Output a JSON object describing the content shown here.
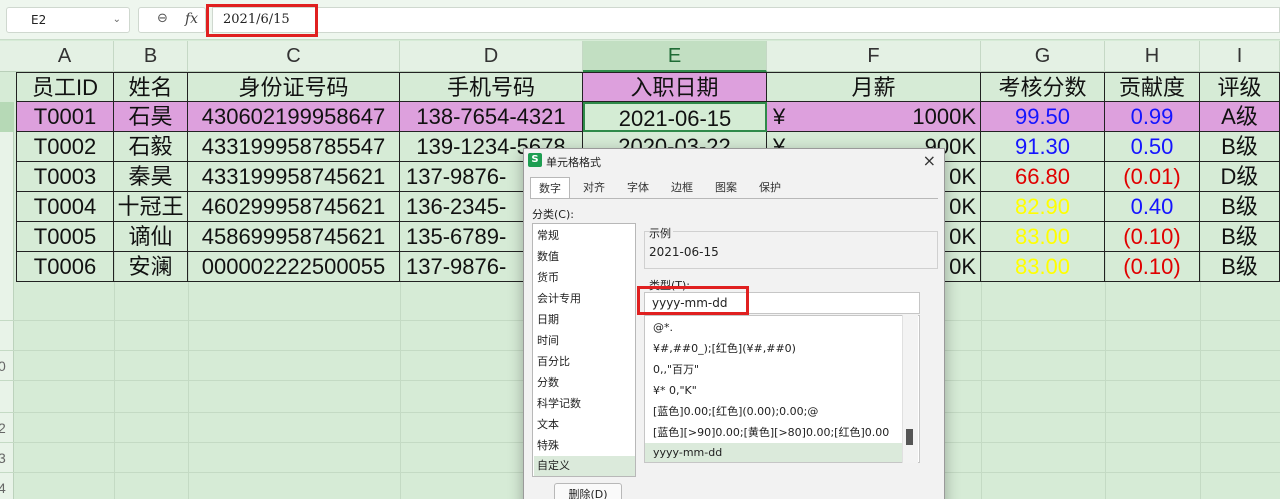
{
  "formula_bar": {
    "namebox": "E2",
    "zoom_icon": "⊖",
    "fx_label": "fx",
    "formula_value": "2021/6/15"
  },
  "columns": [
    "A",
    "B",
    "C",
    "D",
    "E",
    "F",
    "G",
    "H",
    "I"
  ],
  "row_numbers": [
    "0",
    "2",
    "3",
    "4"
  ],
  "table": {
    "headers": [
      "员工ID",
      "姓名",
      "身份证号码",
      "手机号码",
      "入职日期",
      "月薪",
      "考核分数",
      "贡献度",
      "评级"
    ],
    "rows": [
      {
        "id": "T0001",
        "name": "石昊",
        "idcard": "430602199958647",
        "phone": "138-7654-4321",
        "date": "2021-06-15",
        "yen": "¥",
        "salary": "1000K",
        "score": "99.50",
        "contrib": "0.99",
        "grade": "A级"
      },
      {
        "id": "T0002",
        "name": "石毅",
        "idcard": "433199958785547",
        "phone": "139-1234-5678",
        "date": "2020-03-22",
        "yen": "¥",
        "salary": "900K",
        "score": "91.30",
        "contrib": "0.50",
        "grade": "B级"
      },
      {
        "id": "T0003",
        "name": "秦昊",
        "idcard": "433199958745621",
        "phone": "137-9876-",
        "date": "",
        "yen": "",
        "salary": "0K",
        "score": "66.80",
        "contrib": "(0.01)",
        "grade": "D级"
      },
      {
        "id": "T0004",
        "name": "十冠王",
        "idcard": "460299958745621",
        "phone": "136-2345-",
        "date": "",
        "yen": "",
        "salary": "0K",
        "score": "82.90",
        "contrib": "0.40",
        "grade": "B级"
      },
      {
        "id": "T0005",
        "name": "谪仙",
        "idcard": "458699958745621",
        "phone": "135-6789-",
        "date": "",
        "yen": "",
        "salary": "0K",
        "score": "83.00",
        "contrib": "(0.10)",
        "grade": "B级"
      },
      {
        "id": "T0006",
        "name": "安澜",
        "idcard": "000002222500055",
        "phone": "137-9876-",
        "date": "",
        "yen": "",
        "salary": "0K",
        "score": "83.00",
        "contrib": "(0.10)",
        "grade": "B级"
      }
    ]
  },
  "colors": {
    "score_blue": "#1515ff",
    "score_red": "#e00000",
    "score_yellow": "#ffff00",
    "highlight_row": "#dda0dd",
    "annotation_red": "#e02020"
  },
  "dialog": {
    "logo": "S",
    "title": "单元格格式",
    "close": "×",
    "tabs": [
      "数字",
      "对齐",
      "字体",
      "边框",
      "图案",
      "保护"
    ],
    "category_label": "分类(C):",
    "categories": [
      "常规",
      "数值",
      "货币",
      "会计专用",
      "日期",
      "时间",
      "百分比",
      "分数",
      "科学记数",
      "文本",
      "特殊",
      "自定义"
    ],
    "selected_category": "自定义",
    "sample_label": "示例",
    "sample_value": "2021-06-15",
    "type_label": "类型(T):",
    "type_value": "yyyy-mm-dd",
    "formats": [
      "@*.",
      "¥#,##0_);[红色](¥#,##0)",
      "0,,\"百万\"",
      "¥* 0,\"K\"",
      "[蓝色]0.00;[红色](0.00);0.00;@",
      "[蓝色][>90]0.00;[黄色][>80]0.00;[红色]0.00",
      "yyyy-mm-dd"
    ],
    "delete_button": "删除(D)"
  }
}
